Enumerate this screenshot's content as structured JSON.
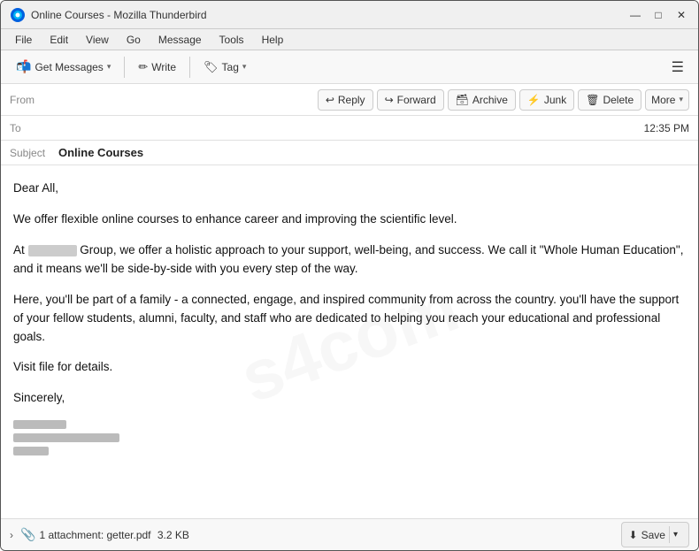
{
  "window": {
    "title": "Online Courses - Mozilla Thunderbird",
    "icon": "thunderbird"
  },
  "window_controls": {
    "minimize": "—",
    "maximize": "□",
    "close": "✕"
  },
  "menu": {
    "items": [
      "File",
      "Edit",
      "View",
      "Go",
      "Message",
      "Tools",
      "Help"
    ]
  },
  "toolbar": {
    "get_messages_label": "Get Messages",
    "write_label": "Write",
    "tag_label": "Tag"
  },
  "action_buttons": {
    "reply_label": "Reply",
    "forward_label": "Forward",
    "archive_label": "Archive",
    "junk_label": "Junk",
    "delete_label": "Delete",
    "more_label": "More"
  },
  "email_header": {
    "from_label": "From",
    "to_label": "To",
    "subject_label": "Subject",
    "subject_value": "Online Courses",
    "time": "12:35 PM"
  },
  "email_body": {
    "greeting": "Dear All,",
    "paragraph1": "We offer flexible online courses to enhance career and improving the scientific level.",
    "paragraph2_prefix": "At",
    "paragraph2_group": "Group, we offer a holistic approach to your support, well-being, and success. We call it \"Whole Human Education\", and it means we'll be side-by-side with you every step of the way.",
    "paragraph3": "Here, you'll be part of a family - a connected, engage, and inspired community from across the country. you'll have the support of your fellow students, alumni, faculty, and staff who are dedicated to helping you reach your educational and professional goals.",
    "paragraph4": "Visit file for details.",
    "closing": "Sincerely,"
  },
  "attachment": {
    "count_text": "1 attachment: getter.pdf",
    "size": "3.2 KB",
    "save_label": "Save"
  },
  "icons": {
    "reply": "↩",
    "forward": "↪",
    "archive": "🗄",
    "junk": "🚫",
    "delete": "🗑",
    "attachment": "📎",
    "save": "⬇",
    "write": "✏",
    "tag": "🏷",
    "hamburger": "☰",
    "chevron_down": "▾",
    "chevron_right": "›"
  }
}
